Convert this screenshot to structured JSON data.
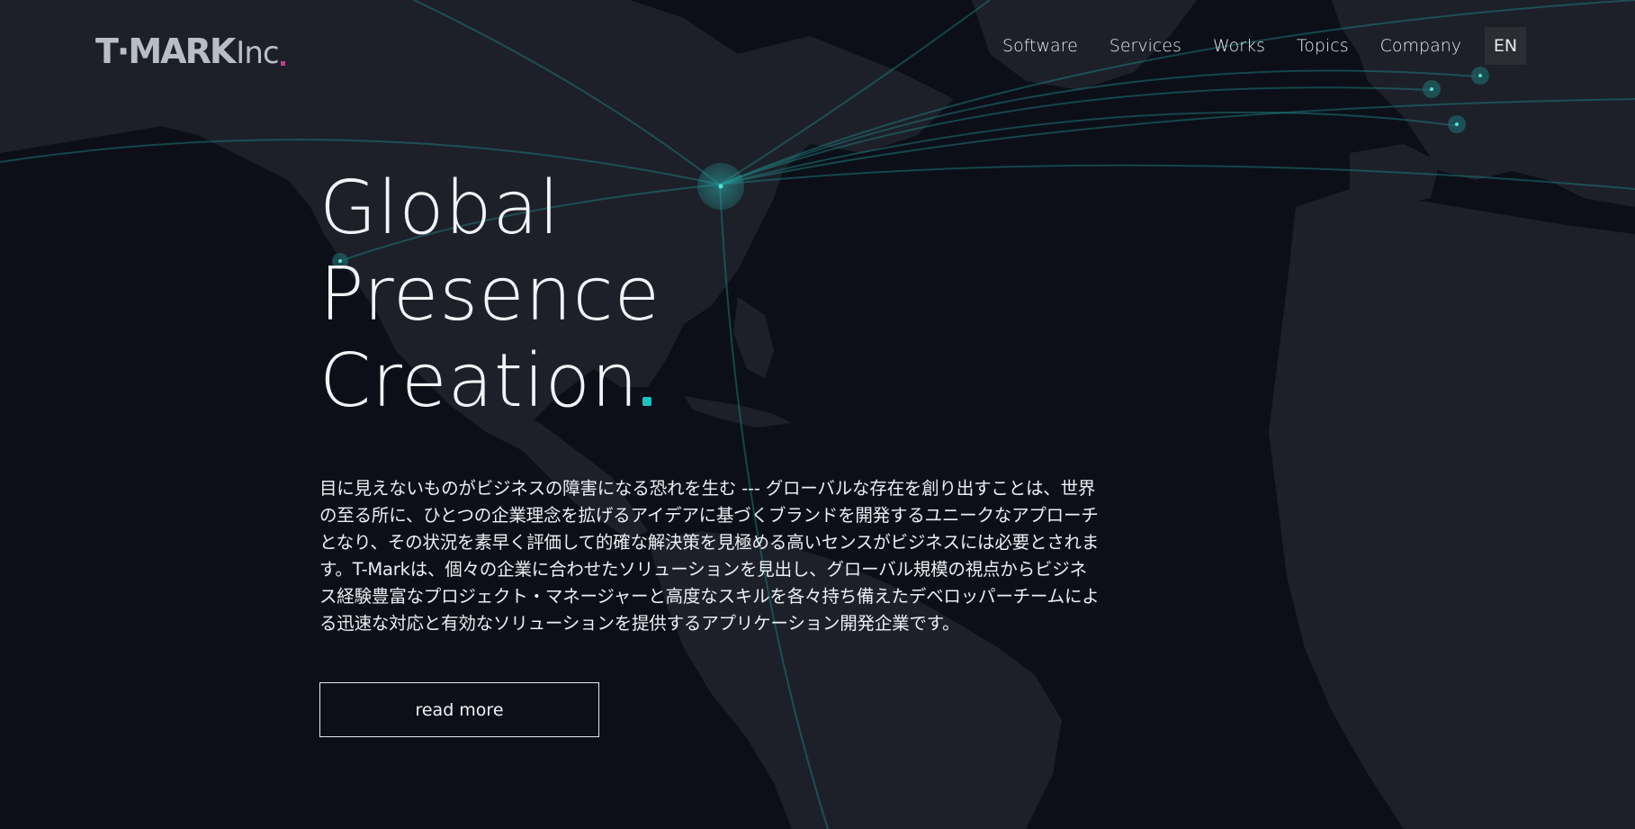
{
  "logo": {
    "mark": "T·MARK",
    "suffix": "Inc",
    "accent_color": "#c43d8c"
  },
  "nav": {
    "items": [
      {
        "label": "Software"
      },
      {
        "label": "Services"
      },
      {
        "label": "Works"
      },
      {
        "label": "Topics"
      },
      {
        "label": "Company"
      }
    ],
    "language": "EN"
  },
  "hero": {
    "lines": [
      "Global",
      "Presence",
      "Creation"
    ],
    "accent_color": "#19c3c0"
  },
  "intro": {
    "text": "目に見えないものがビジネスの障害になる恐れを生む --- グローバルな存在を創り出すことは、世界の至る所に、ひとつの企業理念を拡げるアイデアに基づくブランドを開発するユニークなアプローチとなり、その状況を素早く評価して的確な解決策を見極める高いセンスがビジネスには必要とされます。T-Markは、個々の企業に合わせたソリューションを見出し、グローバル規模の視点からビジネス経験豊富なプロジェクト・マネージャーと高度なスキルを各々持ち備えたデベロッパーチームによる迅速な対応と有効なソリューションを提供するアプリケーション開発企業です。"
  },
  "cta": {
    "label": "read more"
  },
  "colors": {
    "background": "#0c0f17",
    "land": "#1d2029",
    "connection_line": "#1f8a8a"
  }
}
